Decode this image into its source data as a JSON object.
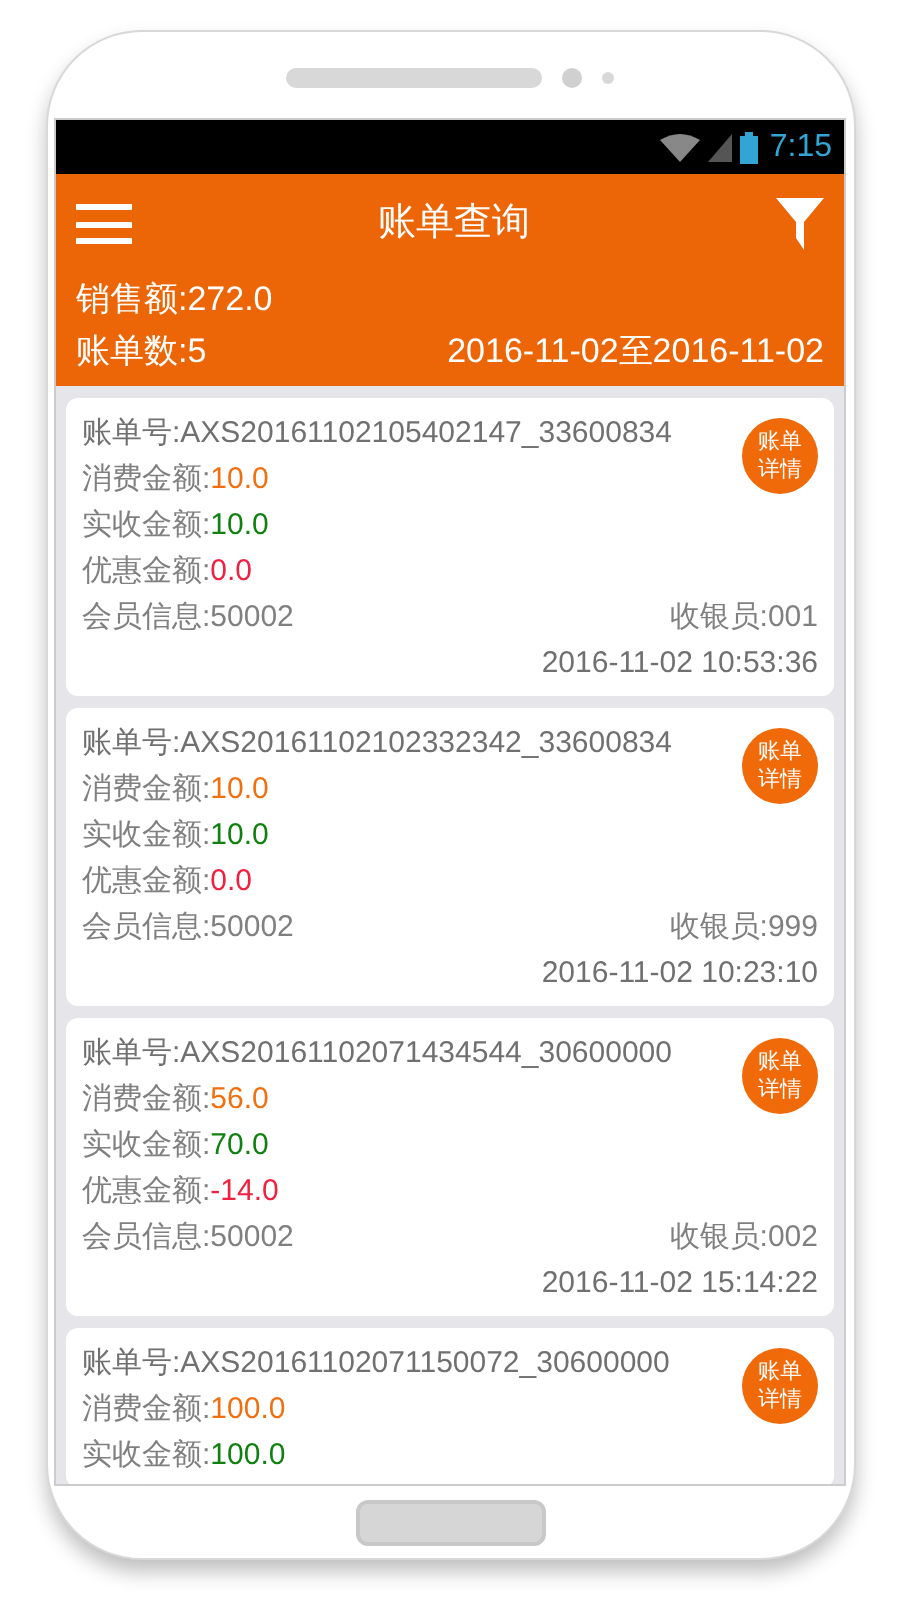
{
  "status_bar": {
    "time": "7:15"
  },
  "header": {
    "title": "账单查询",
    "sales": "销售额:272.0",
    "count": "账单数:5",
    "date_range": "2016-11-02至2016-11-02"
  },
  "bills": [
    {
      "bill_no": "账单号:AXS20161102105402147_33600834",
      "detail_button": [
        "账单",
        "详情"
      ],
      "fields": [
        {
          "label": "消费金额:",
          "value": "10.0",
          "kind": "spent"
        },
        {
          "label": "实收金额:",
          "value": "10.0",
          "kind": "received"
        },
        {
          "label": "优惠金额:",
          "value": "0.0",
          "kind": "discount"
        }
      ],
      "member": "会员信息:50002",
      "cashier": "收银员:001",
      "time": "2016-11-02 10:53:36"
    },
    {
      "bill_no": "账单号:AXS20161102102332342_33600834",
      "detail_button": [
        "账单",
        "详情"
      ],
      "fields": [
        {
          "label": "消费金额:",
          "value": "10.0",
          "kind": "spent"
        },
        {
          "label": "实收金额:",
          "value": "10.0",
          "kind": "received"
        },
        {
          "label": "优惠金额:",
          "value": "0.0",
          "kind": "discount"
        }
      ],
      "member": "会员信息:50002",
      "cashier": "收银员:999",
      "time": "2016-11-02 10:23:10"
    },
    {
      "bill_no": "账单号:AXS20161102071434544_30600000",
      "detail_button": [
        "账单",
        "详情"
      ],
      "fields": [
        {
          "label": "消费金额:",
          "value": "56.0",
          "kind": "spent"
        },
        {
          "label": "实收金额:",
          "value": "70.0",
          "kind": "received"
        },
        {
          "label": "优惠金额:",
          "value": "-14.0",
          "kind": "discount"
        }
      ],
      "member": "会员信息:50002",
      "cashier": "收银员:002",
      "time": "2016-11-02 15:14:22"
    },
    {
      "bill_no": "账单号:AXS20161102071150072_30600000",
      "detail_button": [
        "账单",
        "详情"
      ],
      "fields": [
        {
          "label": "消费金额:",
          "value": "100.0",
          "kind": "spent"
        },
        {
          "label": "实收金额:",
          "value": "100.0",
          "kind": "received"
        }
      ]
    }
  ]
}
